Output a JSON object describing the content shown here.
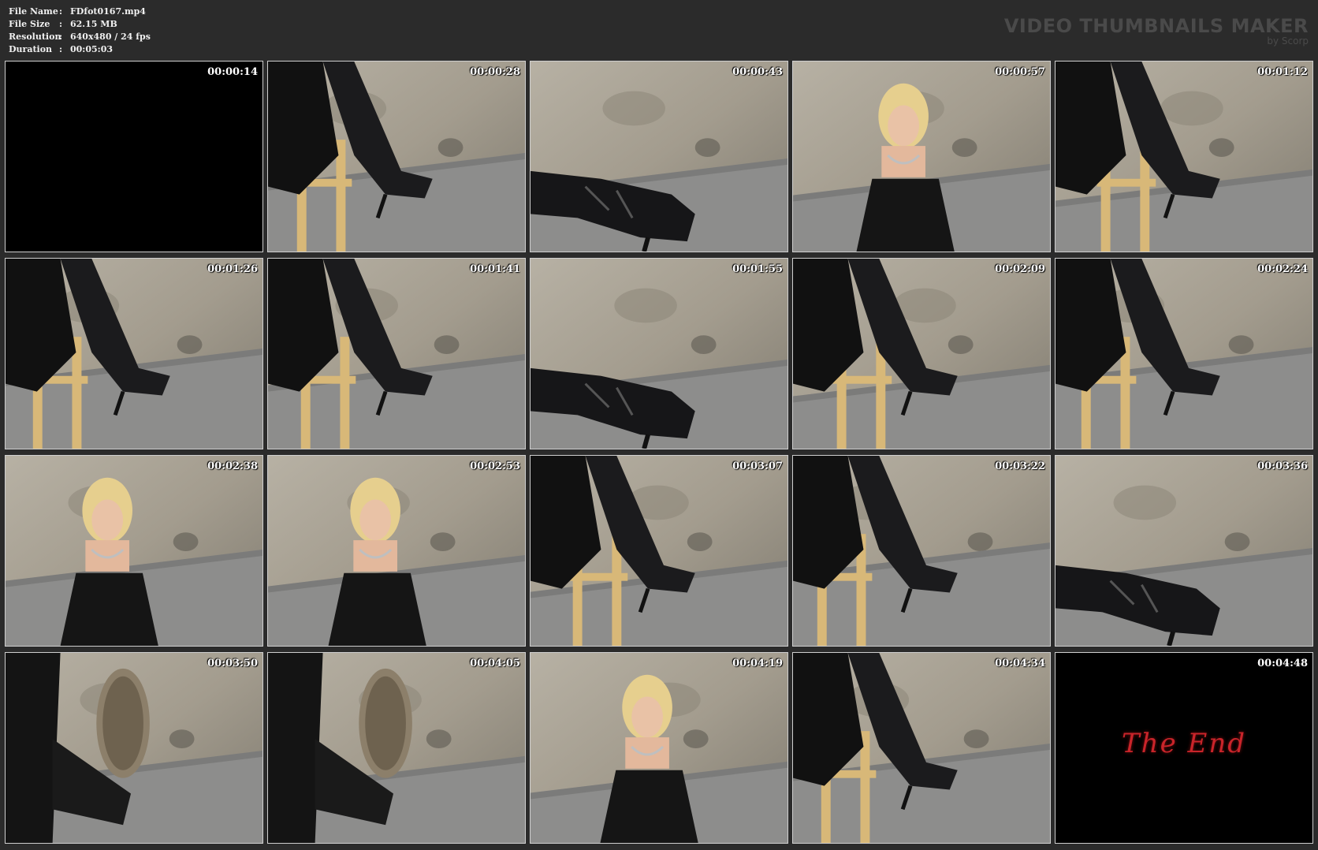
{
  "info": {
    "rows": [
      {
        "label": "File Name",
        "value": "FDfot0167.mp4"
      },
      {
        "label": "File Size",
        "value": "62.15 MB"
      },
      {
        "label": "Resolution",
        "value": "640x480 / 24 fps"
      },
      {
        "label": "Duration",
        "value": "00:05:03"
      }
    ],
    "separator": ":"
  },
  "brand": {
    "title": "VIDEO THUMBNAILS MAKER",
    "subtitle": "by Scorp"
  },
  "thumbnails": [
    {
      "time": "00:00:14",
      "scene": "black"
    },
    {
      "time": "00:00:28",
      "scene": "legs-chair"
    },
    {
      "time": "00:00:43",
      "scene": "boot-closeup"
    },
    {
      "time": "00:00:57",
      "scene": "woman-seated"
    },
    {
      "time": "00:01:12",
      "scene": "legs-chair"
    },
    {
      "time": "00:01:26",
      "scene": "legs-chair"
    },
    {
      "time": "00:01:41",
      "scene": "legs-chair"
    },
    {
      "time": "00:01:55",
      "scene": "boot-closeup"
    },
    {
      "time": "00:02:09",
      "scene": "legs-chair"
    },
    {
      "time": "00:02:24",
      "scene": "legs-chair"
    },
    {
      "time": "00:02:38",
      "scene": "woman-seated"
    },
    {
      "time": "00:02:53",
      "scene": "woman-seated"
    },
    {
      "time": "00:03:07",
      "scene": "legs-chair"
    },
    {
      "time": "00:03:22",
      "scene": "legs-chair"
    },
    {
      "time": "00:03:36",
      "scene": "boot-closeup"
    },
    {
      "time": "00:03:50",
      "scene": "sole-closeup"
    },
    {
      "time": "00:04:05",
      "scene": "sole-closeup"
    },
    {
      "time": "00:04:19",
      "scene": "woman-seated"
    },
    {
      "time": "00:04:34",
      "scene": "legs-chair"
    },
    {
      "time": "00:04:48",
      "scene": "end",
      "caption": "The End"
    }
  ],
  "colors": {
    "background": "#2b2b2b",
    "wall": "#a39c8e",
    "floor": "#8d8d8c",
    "chair": "#d8b878",
    "end_text": "#c9242a"
  }
}
